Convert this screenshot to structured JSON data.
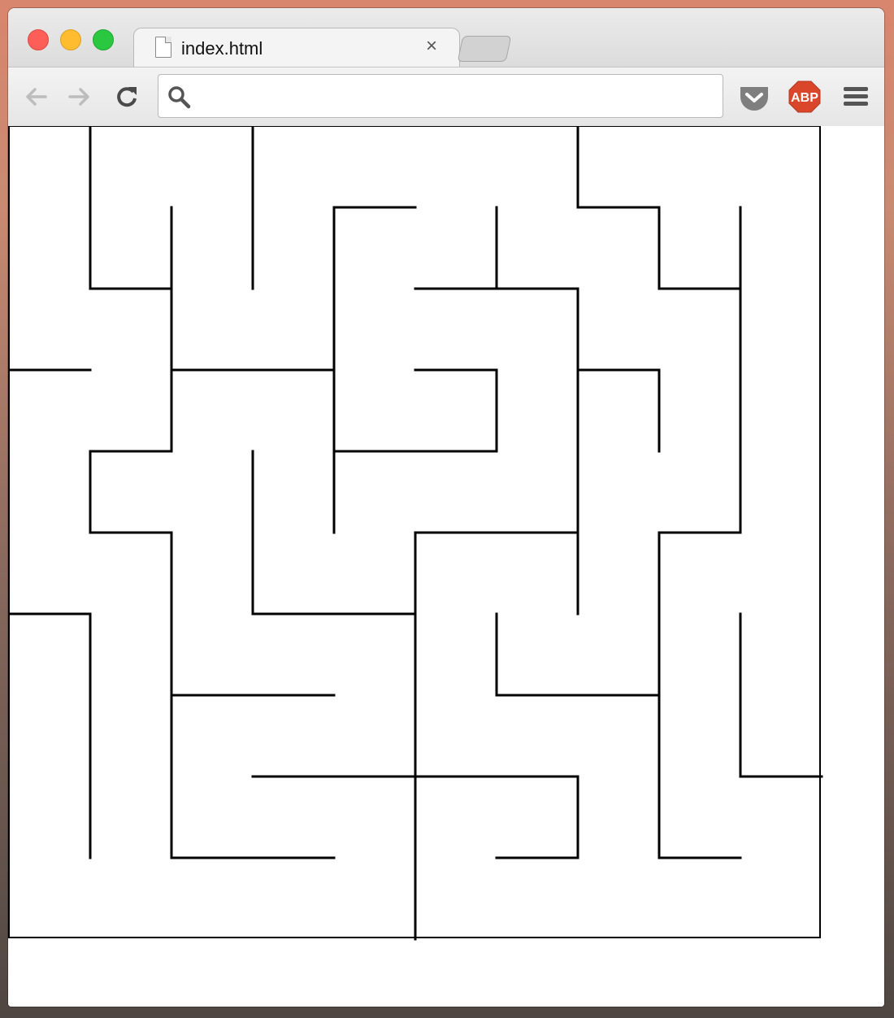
{
  "browser": {
    "tab": {
      "title": "index.html",
      "close_symbol": "×",
      "icon": "document-icon"
    },
    "toolbar": {
      "back_icon": "back-arrow-icon",
      "forward_icon": "forward-arrow-icon",
      "reload_icon": "reload-icon",
      "address_value": "",
      "search_icon": "magnifier-icon",
      "extensions": [
        {
          "name": "pocket",
          "icon": "pocket-icon",
          "color": "#7f7f7f"
        },
        {
          "name": "adblock-plus",
          "label": "ABP",
          "icon": "abp-icon",
          "color": "#d9462a"
        }
      ],
      "menu_icon": "hamburger-menu-icon"
    },
    "traffic_lights": {
      "close": "#fd5e57",
      "minimize": "#febc2e",
      "zoom": "#2ac840"
    }
  },
  "maze": {
    "grid": {
      "cols": 10,
      "rows": 10
    },
    "wall_color": "#000000",
    "walls": [
      [
        1,
        0,
        1,
        2
      ],
      [
        3,
        0,
        3,
        2
      ],
      [
        7,
        0,
        7,
        1
      ],
      [
        1,
        2,
        2,
        2
      ],
      [
        2,
        1,
        2,
        4
      ],
      [
        4,
        1,
        5,
        1
      ],
      [
        4,
        1,
        4,
        5
      ],
      [
        6,
        1,
        6,
        2
      ],
      [
        7,
        1,
        8,
        1
      ],
      [
        8,
        1,
        8,
        2
      ],
      [
        8,
        2,
        9,
        2
      ],
      [
        9,
        1,
        9,
        5
      ],
      [
        5,
        2,
        7,
        2
      ],
      [
        7,
        2,
        7,
        6
      ],
      [
        0,
        3,
        1,
        3
      ],
      [
        2,
        3,
        4,
        3
      ],
      [
        5,
        3,
        6,
        3
      ],
      [
        6,
        3,
        6,
        4
      ],
      [
        7,
        3,
        8,
        3
      ],
      [
        8,
        3,
        8,
        4
      ],
      [
        4,
        4,
        6,
        4
      ],
      [
        1,
        4,
        2,
        4
      ],
      [
        1,
        4,
        1,
        5
      ],
      [
        1,
        5,
        2,
        5
      ],
      [
        2,
        5,
        2,
        9
      ],
      [
        3,
        4,
        3,
        6
      ],
      [
        3,
        6,
        5,
        6
      ],
      [
        5,
        5,
        7,
        5
      ],
      [
        5,
        5,
        5,
        10
      ],
      [
        8,
        5,
        9,
        5
      ],
      [
        8,
        5,
        8,
        9
      ],
      [
        8,
        9,
        9,
        9
      ],
      [
        0,
        6,
        1,
        6
      ],
      [
        1,
        6,
        1,
        9
      ],
      [
        6,
        6,
        6,
        7
      ],
      [
        6,
        7,
        8,
        7
      ],
      [
        9,
        6,
        9,
        8
      ],
      [
        9,
        8,
        10,
        8
      ],
      [
        2,
        7,
        4,
        7
      ],
      [
        3,
        8,
        7,
        8
      ],
      [
        7,
        8,
        7,
        9
      ],
      [
        6,
        9,
        7,
        9
      ],
      [
        2,
        9,
        4,
        9
      ]
    ]
  }
}
